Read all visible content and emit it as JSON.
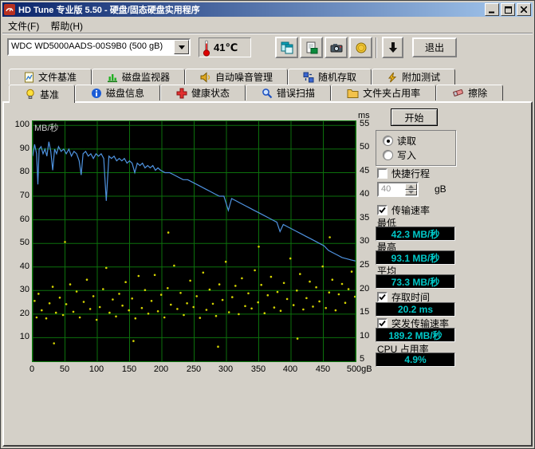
{
  "window": {
    "title": "HD Tune 专业版 5.50 - 硬盘/固态硬盘实用程序"
  },
  "menu": {
    "file": "文件(F)",
    "help": "帮助(H)"
  },
  "toolbar": {
    "drive": "WDC WD5000AADS-00S9B0 (500 gB)",
    "temperature": "41℃",
    "exit": "退出"
  },
  "tabs_back": [
    "文件基准",
    "磁盘监视器",
    "自动噪音管理",
    "随机存取",
    "附加测试"
  ],
  "tabs_front": [
    "基准",
    "磁盘信息",
    "健康状态",
    "错误扫描",
    "文件夹占用率",
    "擦除"
  ],
  "panel": {
    "start": "开始",
    "read": "读取",
    "write": "写入",
    "short_stroke": "快捷行程",
    "short_stroke_value": "40",
    "unit_gb": "gB",
    "transfer_rate": "传输速率",
    "min_label": "最低",
    "min_value": "42.3 MB/秒",
    "max_label": "最高",
    "max_value": "93.1 MB/秒",
    "avg_label": "平均",
    "avg_value": "73.3 MB/秒",
    "access_time": "存取时间",
    "access_time_value": "20.2 ms",
    "burst_rate": "突发传输速率",
    "burst_rate_value": "189.2 MB/秒",
    "cpu_usage": "CPU 占用率",
    "cpu_value": "4.9%",
    "value_color": "#00c8c8"
  },
  "colors": {
    "titlebar_start": "#0a246a",
    "titlebar_end": "#a6caf0",
    "window_bg": "#d4d0c8"
  },
  "chart_data": {
    "type": "line+scatter",
    "x_unit": "gB",
    "x_max": 500,
    "x_ticks": [
      0,
      50,
      100,
      150,
      200,
      250,
      300,
      350,
      400,
      450,
      500
    ],
    "x_tick_labels": [
      "0",
      "50",
      "100",
      "150",
      "200",
      "250",
      "300",
      "350",
      "400",
      "450",
      "500gB"
    ],
    "y_left_label": "MB/秒",
    "y_left_max": 101.8,
    "y_left_ticks": [
      100,
      90,
      80,
      70,
      60,
      50,
      40,
      30,
      20,
      10
    ],
    "y_right_label": "ms",
    "y_right_min": 4.7,
    "y_right_max": 55.6,
    "y_right_ticks": [
      55,
      50,
      45,
      40,
      35,
      30,
      25,
      20,
      15,
      10,
      5
    ],
    "grid_color": "#0c700c",
    "background": "#000000",
    "legend": "off",
    "series": [
      {
        "name": "transfer-rate",
        "type": "line",
        "axis": "left",
        "unit": "MB/秒",
        "color": "#4f93e0",
        "points": [
          [
            0,
            87
          ],
          [
            3,
            92
          ],
          [
            6,
            88
          ],
          [
            8,
            75
          ],
          [
            10,
            90
          ],
          [
            13,
            91
          ],
          [
            16,
            88
          ],
          [
            19,
            90
          ],
          [
            22,
            87
          ],
          [
            25,
            93.1
          ],
          [
            28,
            89
          ],
          [
            31,
            81
          ],
          [
            34,
            90
          ],
          [
            37,
            88
          ],
          [
            40,
            91
          ],
          [
            44,
            89
          ],
          [
            48,
            90
          ],
          [
            52,
            88
          ],
          [
            56,
            90
          ],
          [
            60,
            87
          ],
          [
            64,
            89
          ],
          [
            68,
            88
          ],
          [
            72,
            85
          ],
          [
            75,
            79
          ],
          [
            78,
            88
          ],
          [
            82,
            89
          ],
          [
            86,
            87
          ],
          [
            90,
            88
          ],
          [
            94,
            86
          ],
          [
            98,
            88
          ],
          [
            102,
            87
          ],
          [
            106,
            88
          ],
          [
            110,
            86
          ],
          [
            114,
            68
          ],
          [
            118,
            87
          ],
          [
            122,
            86
          ],
          [
            126,
            87
          ],
          [
            130,
            85
          ],
          [
            134,
            86
          ],
          [
            138,
            85
          ],
          [
            142,
            86
          ],
          [
            146,
            84
          ],
          [
            150,
            85
          ],
          [
            154,
            84
          ],
          [
            158,
            80
          ],
          [
            162,
            84
          ],
          [
            166,
            83
          ],
          [
            170,
            84
          ],
          [
            174,
            82
          ],
          [
            178,
            83
          ],
          [
            182,
            82
          ],
          [
            186,
            83
          ],
          [
            190,
            81
          ],
          [
            194,
            82
          ],
          [
            198,
            81
          ],
          [
            205,
            80
          ],
          [
            212,
            80
          ],
          [
            219,
            79
          ],
          [
            226,
            78
          ],
          [
            233,
            77
          ],
          [
            240,
            77
          ],
          [
            247,
            76
          ],
          [
            254,
            75
          ],
          [
            261,
            74
          ],
          [
            268,
            73
          ],
          [
            275,
            72
          ],
          [
            282,
            71
          ],
          [
            289,
            70
          ],
          [
            296,
            70
          ],
          [
            303,
            64
          ],
          [
            308,
            69
          ],
          [
            315,
            68
          ],
          [
            322,
            67
          ],
          [
            329,
            66
          ],
          [
            336,
            65
          ],
          [
            343,
            64
          ],
          [
            350,
            63
          ],
          [
            357,
            62
          ],
          [
            364,
            61
          ],
          [
            371,
            60
          ],
          [
            378,
            59
          ],
          [
            383,
            55
          ],
          [
            388,
            58
          ],
          [
            395,
            57
          ],
          [
            402,
            56
          ],
          [
            409,
            55
          ],
          [
            416,
            54
          ],
          [
            423,
            53
          ],
          [
            430,
            52
          ],
          [
            437,
            51
          ],
          [
            444,
            50
          ],
          [
            451,
            49
          ],
          [
            458,
            47
          ],
          [
            465,
            46
          ],
          [
            472,
            45
          ],
          [
            479,
            44
          ],
          [
            486,
            43.5
          ],
          [
            493,
            43
          ],
          [
            500,
            42.5
          ]
        ]
      },
      {
        "name": "access-time",
        "type": "scatter",
        "axis": "right",
        "unit": "ms",
        "color": "#d4d400",
        "points": [
          [
            3,
            17.5
          ],
          [
            6,
            14
          ],
          [
            9,
            19
          ],
          [
            14,
            15.5
          ],
          [
            21,
            13.8
          ],
          [
            26,
            17
          ],
          [
            31,
            20.5
          ],
          [
            33,
            8.5
          ],
          [
            36,
            15
          ],
          [
            42,
            18.2
          ],
          [
            47,
            14.5
          ],
          [
            50,
            30
          ],
          [
            52,
            16.8
          ],
          [
            58,
            21
          ],
          [
            63,
            15.2
          ],
          [
            68,
            19.5
          ],
          [
            73,
            14
          ],
          [
            79,
            17.3
          ],
          [
            84,
            22
          ],
          [
            89,
            15.8
          ],
          [
            94,
            18.5
          ],
          [
            99,
            13.5
          ],
          [
            104,
            16.2
          ],
          [
            109,
            20
          ],
          [
            114,
            24.5
          ],
          [
            119,
            15
          ],
          [
            124,
            17.8
          ],
          [
            129,
            14.2
          ],
          [
            134,
            19
          ],
          [
            139,
            16.5
          ],
          [
            144,
            21.5
          ],
          [
            149,
            15.5
          ],
          [
            154,
            18
          ],
          [
            156,
            9
          ],
          [
            159,
            13.8
          ],
          [
            164,
            22.8
          ],
          [
            169,
            16
          ],
          [
            174,
            19.8
          ],
          [
            179,
            14.8
          ],
          [
            184,
            17.5
          ],
          [
            189,
            23
          ],
          [
            194,
            15.3
          ],
          [
            199,
            18.8
          ],
          [
            204,
            14
          ],
          [
            209,
            20.2
          ],
          [
            210,
            32
          ],
          [
            214,
            16.7
          ],
          [
            219,
            25
          ],
          [
            224,
            15.8
          ],
          [
            229,
            19.2
          ],
          [
            234,
            14.5
          ],
          [
            239,
            17
          ],
          [
            244,
            21.8
          ],
          [
            249,
            16.2
          ],
          [
            254,
            18.5
          ],
          [
            259,
            13.9
          ],
          [
            264,
            23.5
          ],
          [
            269,
            15.6
          ],
          [
            274,
            19.9
          ],
          [
            279,
            16.9
          ],
          [
            284,
            14.3
          ],
          [
            287,
            7.8
          ],
          [
            289,
            21
          ],
          [
            294,
            17.7
          ],
          [
            299,
            25.8
          ],
          [
            304,
            15.1
          ],
          [
            309,
            18.3
          ],
          [
            314,
            20.7
          ],
          [
            319,
            14.7
          ],
          [
            324,
            22.3
          ],
          [
            329,
            16.4
          ],
          [
            334,
            19.1
          ],
          [
            339,
            15.9
          ],
          [
            344,
            24
          ],
          [
            349,
            17.2
          ],
          [
            350,
            29
          ],
          [
            354,
            20.9
          ],
          [
            359,
            14.9
          ],
          [
            364,
            18.7
          ],
          [
            369,
            22.6
          ],
          [
            374,
            16.1
          ],
          [
            379,
            19.4
          ],
          [
            384,
            15.4
          ],
          [
            389,
            21.3
          ],
          [
            394,
            17.9
          ],
          [
            399,
            26.5
          ],
          [
            404,
            16.6
          ],
          [
            409,
            19.7
          ],
          [
            410,
            9.5
          ],
          [
            414,
            23.2
          ],
          [
            419,
            15.7
          ],
          [
            424,
            18.1
          ],
          [
            429,
            21.6
          ],
          [
            434,
            16.3
          ],
          [
            439,
            20.4
          ],
          [
            444,
            17.4
          ],
          [
            449,
            24.8
          ],
          [
            454,
            16
          ],
          [
            459,
            19.3
          ],
          [
            460,
            31
          ],
          [
            464,
            22
          ],
          [
            469,
            15.5
          ],
          [
            474,
            18.9
          ],
          [
            479,
            21.1
          ],
          [
            484,
            17.1
          ],
          [
            489,
            20
          ],
          [
            494,
            23.7
          ],
          [
            499,
            18.4
          ]
        ]
      }
    ]
  }
}
